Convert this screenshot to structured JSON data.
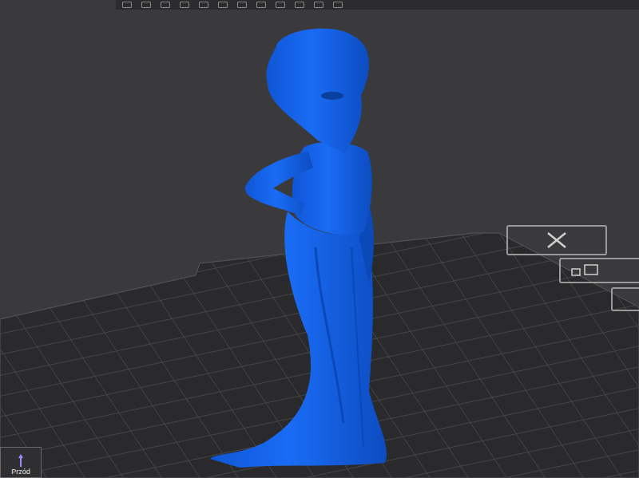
{
  "viewport": {
    "view_cube": {
      "label": "Przód"
    }
  }
}
